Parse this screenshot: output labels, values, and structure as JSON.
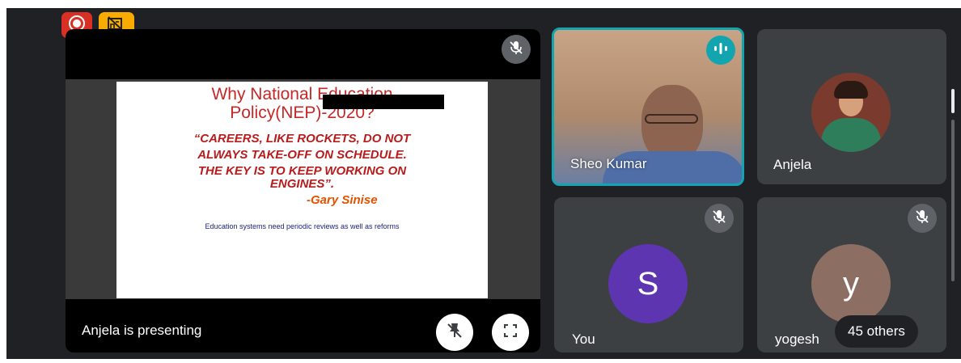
{
  "top_badges": {
    "record_icon": "record-icon",
    "no_video_icon": "no-video-icon",
    "record_color": "#d93025",
    "no_video_color": "#f9ab00"
  },
  "presentation": {
    "footer_label": "Anjela is presenting",
    "slide": {
      "title_line1": "Why National Education",
      "title_line2": "Policy(NEP)-2020?",
      "quote_line1": "“CAREERS, LIKE ROCKETS, DO NOT",
      "quote_line2": "ALWAYS TAKE-OFF ON SCHEDULE.",
      "quote_line3": "THE KEY IS TO KEEP WORKING ON",
      "quote_line4": "ENGINES”.",
      "attribution": "-Gary Sinise",
      "footnote": "Education systems need periodic reviews as well as reforms"
    }
  },
  "participants": [
    {
      "name": "Sheo Kumar",
      "state": "speaking"
    },
    {
      "name": "Anjela",
      "state": "muted"
    },
    {
      "name": "You",
      "initial": "S",
      "avatar_color": "#5e35b1"
    },
    {
      "name": "yogesh",
      "initial": "y",
      "avatar_color": "#8d6e63"
    }
  ],
  "others_badge": "45 others",
  "colors": {
    "background": "#202124",
    "tile": "#3c4043",
    "speaking_border": "#12a4af"
  }
}
